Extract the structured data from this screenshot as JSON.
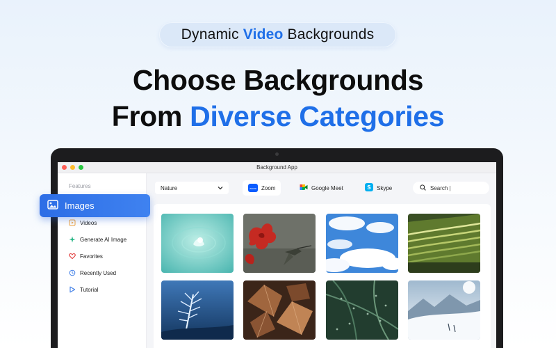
{
  "banner": {
    "pre": "Dynamic",
    "accent": "Video",
    "post": "Backgrounds"
  },
  "headline": {
    "line1": "Choose Backgrounds",
    "line2_plain": "From",
    "line2_accent": "Diverse Categories"
  },
  "window": {
    "title": "Background App"
  },
  "sidebar": {
    "section_label": "Features",
    "active_item": {
      "label": "Images",
      "icon": "image-icon"
    },
    "items": [
      {
        "label": "Videos",
        "icon": "video-icon"
      },
      {
        "label": "Generate AI Image",
        "icon": "sparkle-icon"
      },
      {
        "label": "Favorites",
        "icon": "heart-icon"
      },
      {
        "label": "Recently Used",
        "icon": "history-icon"
      },
      {
        "label": "Tutorial",
        "icon": "play-icon"
      }
    ]
  },
  "toolbar": {
    "category": {
      "value": "Nature"
    },
    "apps": [
      {
        "label": "Zoom",
        "logo_text": "zoom",
        "active": true
      },
      {
        "label": "Google Meet",
        "active": false
      },
      {
        "label": "Skype",
        "active": false
      }
    ],
    "search": {
      "value": "Search |"
    }
  },
  "gallery": {
    "images": [
      {
        "subject": "water-droplet",
        "colors": [
          "#6ecfc6",
          "#9fe0d8"
        ]
      },
      {
        "subject": "hummingbird-hibiscus",
        "colors": [
          "#6d7068",
          "#b8231c"
        ]
      },
      {
        "subject": "blue-sky-clouds",
        "colors": [
          "#3d86d8",
          "#ffffff"
        ]
      },
      {
        "subject": "rice-terraces",
        "colors": [
          "#3f5a2a",
          "#d6e08a"
        ]
      },
      {
        "subject": "frost-crystal",
        "colors": [
          "#1f4e85",
          "#d9ecff"
        ]
      },
      {
        "subject": "autumn-leaves",
        "colors": [
          "#3a2418",
          "#b5744a"
        ]
      },
      {
        "subject": "rain-pine-branches",
        "colors": [
          "#1f3a2c",
          "#6b8f76"
        ]
      },
      {
        "subject": "snowy-mountains",
        "colors": [
          "#a7bfd3",
          "#f5f8fb"
        ]
      }
    ]
  },
  "colors": {
    "accent": "#1f6fe8",
    "active_tab": "#2d6ee6"
  }
}
